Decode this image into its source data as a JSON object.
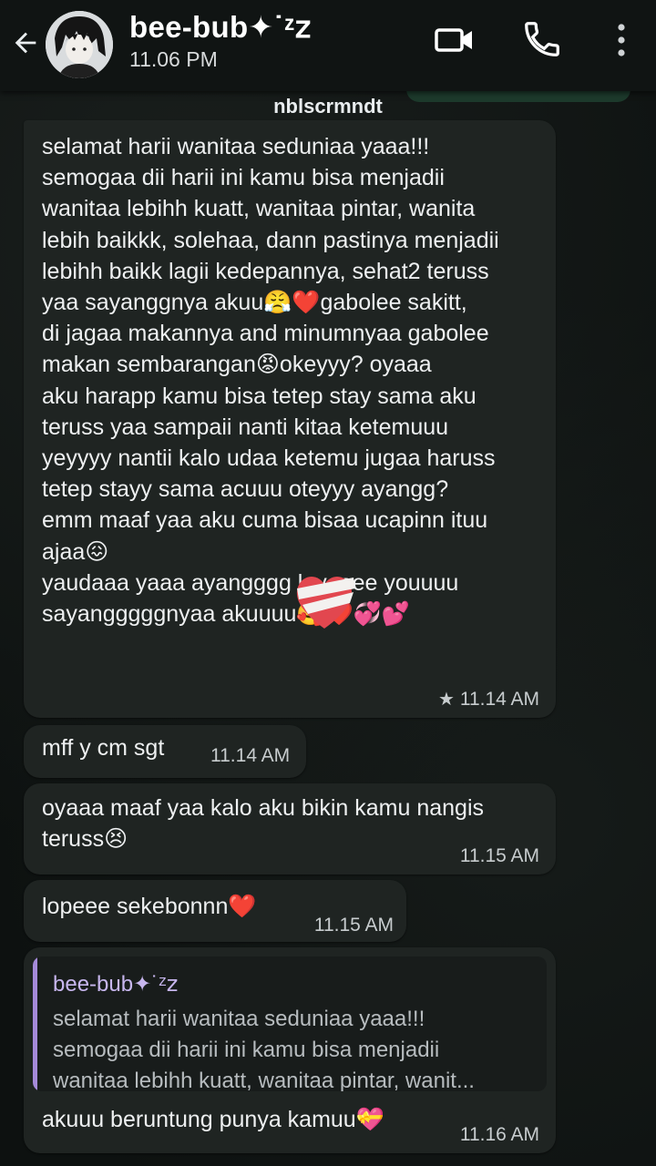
{
  "header": {
    "contact_name": "bee-bub✦˙ᶻ𝗓",
    "last_seen": "11.06 PM"
  },
  "chat": {
    "sender_label": "nblscrmndt",
    "messages": [
      {
        "text": "selamat harii wanitaa seduniaa yaaa!!!\nsemogaa dii harii ini kamu bisa menjadii\nwanitaa lebihh kuatt, wanitaa pintar, wanita\nlebih baikkk, solehaa, dann pastinya menjadii\nlebihh baikk lagii kedepannya, sehat2 teruss\nyaa sayanggnya akuu😤❤️gabolee sakitt,\ndi jagaa makannya and minumnyaa gabolee\nmakan sembarangan😡okeyyy? oyaaa\naku harapp kamu bisa tetep stay sama aku\nteruss yaa sampaii nanti kitaa ketemuuu\nyeyyyy nantii kalo udaa ketemu jugaa haruss\ntetep stayy sama acuuu oteyyy ayangg?\nemm maaf yaa aku cuma bisaa ucapinn ituu\najaa😖\nyaudaaa yaaa ayangggg loveeee youuuu\nsayangggggnyaa akuuuu🥰❤️💞💕",
        "time": "11.14 AM",
        "starred": true
      },
      {
        "text": "mff y cm sgt",
        "time": "11.14 AM"
      },
      {
        "text": "oyaaa maaf yaa kalo aku bikin kamu nangis\nteruss😣",
        "time": "11.15 AM"
      },
      {
        "text": "lopeee sekebonnn❤️",
        "time": "11.15 AM"
      },
      {
        "quote": {
          "name": "bee-bub✦˙ᶻ𝗓",
          "text": "selamat harii wanitaa seduniaa yaaa!!!\nsemogaa dii harii ini kamu bisa menjadii\nwanitaa lebihh kuatt, wanitaa pintar, wanit..."
        },
        "text": "akuuu beruntung punya kamuu💝",
        "time": "11.16 AM"
      }
    ]
  },
  "icons": {
    "back": "arrow-left-icon",
    "video": "video-camera-icon",
    "call": "phone-icon",
    "menu": "more-vert-icon",
    "star": "★"
  },
  "colors": {
    "bubble": "#1f2422",
    "background": "#0d1110",
    "quote_accent": "#a58ad9"
  }
}
